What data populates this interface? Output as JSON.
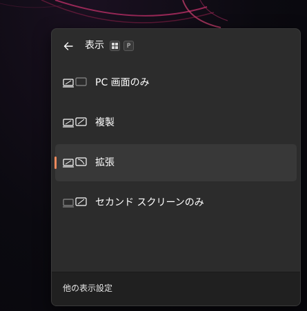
{
  "header": {
    "title": "表示",
    "shortcut_key": "P",
    "back_icon": "arrow-left-icon",
    "windows_icon": "windows-logo-icon"
  },
  "options": [
    {
      "label": "PC 画面のみ",
      "icon": "pc-screen-only-icon",
      "selected": false
    },
    {
      "label": "複製",
      "icon": "duplicate-icon",
      "selected": false
    },
    {
      "label": "拡張",
      "icon": "extend-icon",
      "selected": true
    },
    {
      "label": "セカンド スクリーンのみ",
      "icon": "second-screen-only-icon",
      "selected": false
    }
  ],
  "footer": {
    "link_label": "他の表示設定"
  },
  "colors": {
    "panel_bg": "#2c2c2c",
    "selected_bg": "#383838",
    "accent_indicator": "#f08a5d",
    "footer_bg": "#202020"
  }
}
